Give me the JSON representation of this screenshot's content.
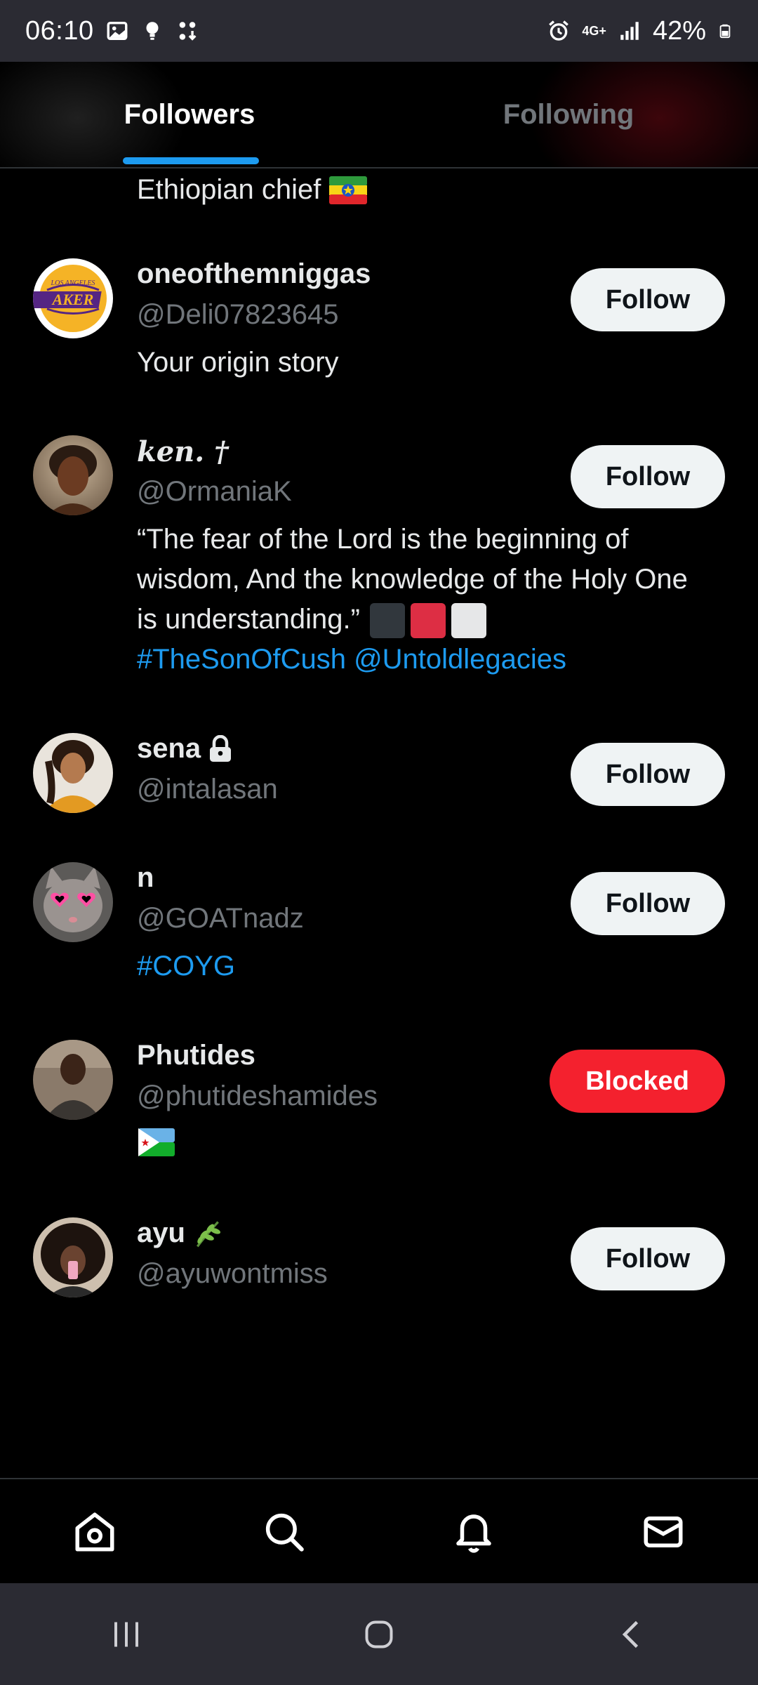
{
  "status_bar": {
    "time": "06:10",
    "network": "4G+",
    "battery": "42%",
    "icons": [
      "image-icon",
      "bulb-icon",
      "download-icon",
      "alarm-icon",
      "signal-icon",
      "battery-icon"
    ]
  },
  "tabs": [
    {
      "label": "Followers",
      "active": true
    },
    {
      "label": "Following",
      "active": false
    }
  ],
  "prev_bio": "Ethiopian chief",
  "users": [
    {
      "name": "oneofthemniggas",
      "handle": "@Deli07823645",
      "bio": "Your origin story",
      "button": "Follow",
      "avatar": "lakers-logo"
    },
    {
      "name": "ken. †",
      "handle": "@OrmaniaK",
      "bio": "“The fear of the Lord is the beginning of wisdom, And the knowledge of the Holy One is understanding.”",
      "bio_links": "#TheSonOfCush @Untoldlegacies",
      "button": "Follow",
      "avatar": "portrait"
    },
    {
      "name": "sena",
      "handle": "@intalasan",
      "bio": "",
      "button": "Follow",
      "avatar": "portrait",
      "locked": true
    },
    {
      "name": "n",
      "handle": "@GOATnadz",
      "bio_links": "#COYG",
      "button": "Follow",
      "avatar": "cat"
    },
    {
      "name": "Phutides",
      "handle": "@phutideshamides",
      "bio": "",
      "button": "Blocked",
      "avatar": "portrait",
      "flag": "djibouti"
    },
    {
      "name": "ayu",
      "handle": "@ayuwontmiss",
      "bio": "",
      "button": "Follow",
      "avatar": "portrait"
    }
  ],
  "bottom_nav": [
    "home-icon",
    "search-icon",
    "notifications-icon",
    "messages-icon"
  ],
  "system_nav": [
    "recents-icon",
    "home-circle-icon",
    "back-icon"
  ],
  "colors": {
    "accent": "#1d9bf0",
    "blocked": "#f4212e",
    "muted": "#71767b",
    "button_bg": "#eff3f4"
  }
}
